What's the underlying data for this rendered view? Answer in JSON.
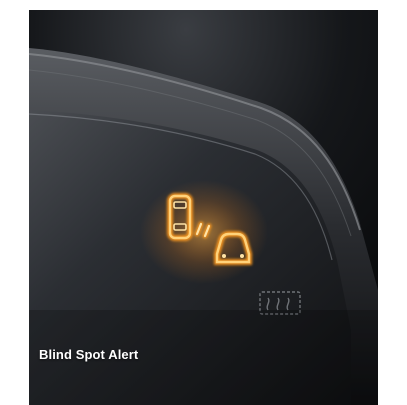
{
  "caption": {
    "text": "Blind Spot Alert"
  },
  "colors": {
    "alert_glow": "#ff9a1f",
    "alert_core": "#ffd27a",
    "mirror_dark": "#0b0c0e",
    "housing": "#2e3034"
  },
  "icons": {
    "alert": "blind-spot-alert-icon",
    "defrost": "mirror-defrost-icon"
  }
}
